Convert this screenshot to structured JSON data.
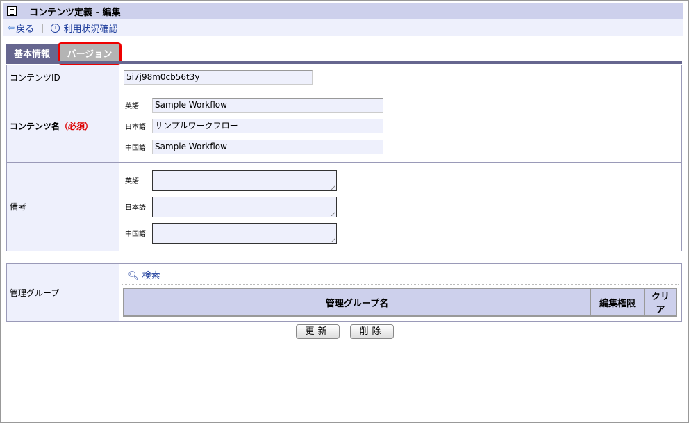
{
  "title": "コンテンツ定義 - 編集",
  "toolbar": {
    "back": "戻る",
    "usage": "利用状況確認"
  },
  "tabs": [
    "基本情報",
    "バージョン"
  ],
  "form": {
    "id_label": "コンテンツID",
    "id_value": "5i7j98m0cb56t3y",
    "name_label": "コンテンツ名",
    "required": "（必須）",
    "langs": [
      "英語",
      "日本語",
      "中国語"
    ],
    "names": [
      "Sample Workflow",
      "サンプルワークフロー",
      "Sample Workflow"
    ],
    "remarks_label": "備考",
    "group_label": "管理グループ",
    "search": "検索",
    "group_cols": [
      "管理グループ名",
      "編集権限",
      "クリア"
    ]
  },
  "buttons": {
    "update": "更新",
    "delete": "削除"
  }
}
